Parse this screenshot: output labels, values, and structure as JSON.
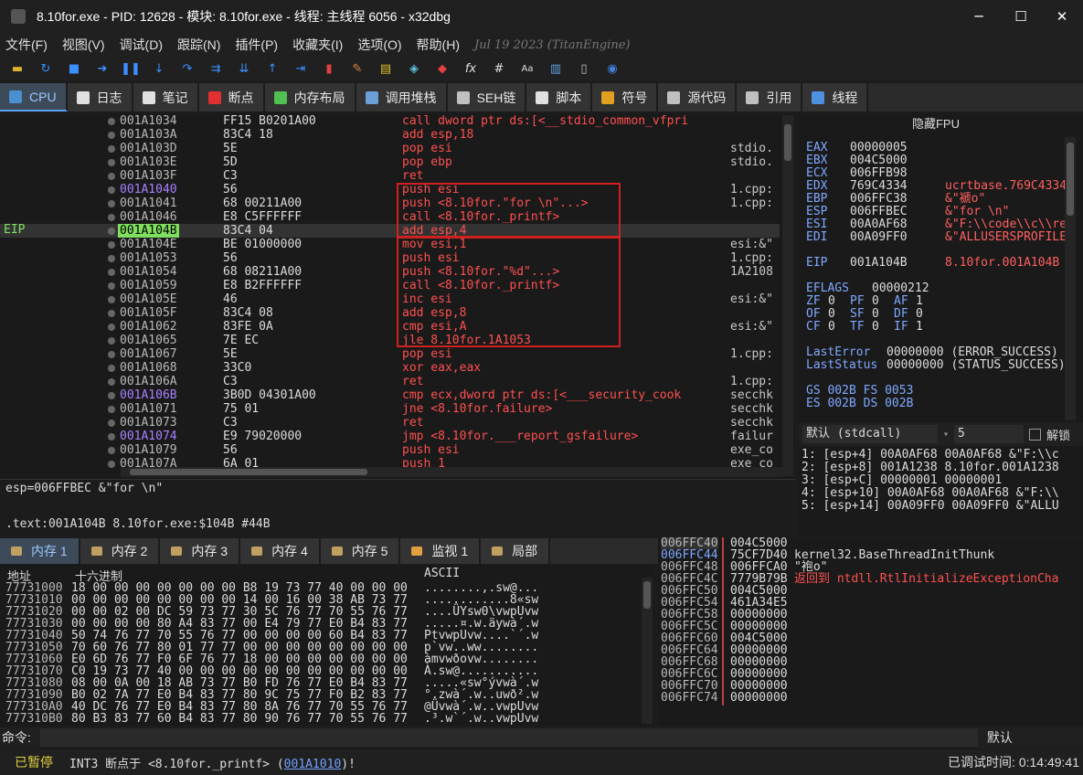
{
  "window": {
    "title": "8.10for.exe - PID: 12628 - 模块: 8.10for.exe - 线程: 主线程 6056 - x32dbg"
  },
  "menu": [
    "文件(F)",
    "视图(V)",
    "调试(D)",
    "跟踪(N)",
    "插件(P)",
    "收藏夹(I)",
    "选项(O)",
    "帮助(H)"
  ],
  "menu_date": "Jul 19 2023 (TitanEngine)",
  "tabs": [
    {
      "label": "CPU",
      "icon": "cpu-icon",
      "color": "#4a8fd0"
    },
    {
      "label": "日志",
      "icon": "log-icon",
      "color": "#e0e0e0"
    },
    {
      "label": "笔记",
      "icon": "notes-icon",
      "color": "#e0e0e0"
    },
    {
      "label": "断点",
      "icon": "breakpoint-icon",
      "color": "#e03030"
    },
    {
      "label": "内存布局",
      "icon": "memory-map-icon",
      "color": "#50c050"
    },
    {
      "label": "调用堆栈",
      "icon": "call-stack-icon",
      "color": "#6a9fd8"
    },
    {
      "label": "SEH链",
      "icon": "seh-icon",
      "color": "#c0c0c0"
    },
    {
      "label": "脚本",
      "icon": "script-icon",
      "color": "#e0e0e0"
    },
    {
      "label": "符号",
      "icon": "symbols-icon",
      "color": "#e0a020"
    },
    {
      "label": "源代码",
      "icon": "source-icon",
      "color": "#c0c0c0"
    },
    {
      "label": "引用",
      "icon": "references-icon",
      "color": "#c0c0c0"
    },
    {
      "label": "线程",
      "icon": "threads-icon",
      "color": "#5090e0"
    }
  ],
  "eip_label": "EIP",
  "disasm": [
    {
      "addr": "001A1034",
      "bytes": "FF15 B0201A00",
      "ins": "call dword ptr ds:[<__stdio_common_vfpri",
      "cmt": "",
      "lbl": false
    },
    {
      "addr": "001A103A",
      "bytes": "83C4 18",
      "ins": "add esp,18",
      "cmt": "",
      "lbl": false
    },
    {
      "addr": "001A103D",
      "bytes": "5E",
      "ins": "pop esi",
      "cmt": "stdio.",
      "lbl": false
    },
    {
      "addr": "001A103E",
      "bytes": "5D",
      "ins": "pop ebp",
      "cmt": "stdio.",
      "lbl": false
    },
    {
      "addr": "001A103F",
      "bytes": "C3",
      "ins": "ret",
      "cmt": "",
      "lbl": false
    },
    {
      "addr": "001A1040",
      "bytes": "56",
      "ins": "push esi",
      "cmt": "1.cpp:",
      "lbl": true
    },
    {
      "addr": "001A1041",
      "bytes": "68 00211A00",
      "ins": "push <8.10for.\"for \\n\"...>",
      "cmt": "1.cpp:",
      "lbl": false
    },
    {
      "addr": "001A1046",
      "bytes": "E8 C5FFFFFF",
      "ins": "call <8.10for._printf>",
      "cmt": "",
      "lbl": false
    },
    {
      "addr": "001A104B",
      "bytes": "83C4 04",
      "ins": "add esp,4",
      "cmt": "",
      "lbl": false,
      "eip": true
    },
    {
      "addr": "001A104E",
      "bytes": "BE 01000000",
      "ins": "mov esi,1",
      "cmt": "esi:&\"",
      "lbl": false
    },
    {
      "addr": "001A1053",
      "bytes": "56",
      "ins": "push esi",
      "cmt": "1.cpp:",
      "lbl": false
    },
    {
      "addr": "001A1054",
      "bytes": "68 08211A00",
      "ins": "push <8.10for.\"%d\"...>",
      "cmt": "1A2108",
      "lbl": false
    },
    {
      "addr": "001A1059",
      "bytes": "E8 B2FFFFFF",
      "ins": "call <8.10for._printf>",
      "cmt": "",
      "lbl": false
    },
    {
      "addr": "001A105E",
      "bytes": "46",
      "ins": "inc esi",
      "cmt": "esi:&\"",
      "lbl": false
    },
    {
      "addr": "001A105F",
      "bytes": "83C4 08",
      "ins": "add esp,8",
      "cmt": "",
      "lbl": false
    },
    {
      "addr": "001A1062",
      "bytes": "83FE 0A",
      "ins": "cmp esi,A",
      "cmt": "esi:&\"",
      "lbl": false
    },
    {
      "addr": "001A1065",
      "bytes": "7E EC",
      "ins": "jle 8.10for.1A1053",
      "cmt": "",
      "lbl": false
    },
    {
      "addr": "001A1067",
      "bytes": "5E",
      "ins": "pop esi",
      "cmt": "1.cpp:",
      "lbl": false
    },
    {
      "addr": "001A1068",
      "bytes": "33C0",
      "ins": "xor eax,eax",
      "cmt": "",
      "lbl": false
    },
    {
      "addr": "001A106A",
      "bytes": "C3",
      "ins": "ret",
      "cmt": "1.cpp:",
      "lbl": false
    },
    {
      "addr": "001A106B",
      "bytes": "3B0D 04301A00",
      "ins": "cmp ecx,dword ptr ds:[<___security_cook",
      "cmt": "secchk",
      "lbl": true
    },
    {
      "addr": "001A1071",
      "bytes": "75 01",
      "ins": "jne <8.10for.failure>",
      "cmt": "secchk",
      "lbl": false
    },
    {
      "addr": "001A1073",
      "bytes": "C3",
      "ins": "ret",
      "cmt": "secchk",
      "lbl": false
    },
    {
      "addr": "001A1074",
      "bytes": "E9 79020000",
      "ins": "jmp <8.10for.___report_gsfailure>",
      "cmt": "failur",
      "lbl": true
    },
    {
      "addr": "001A1079",
      "bytes": "56",
      "ins": "push esi",
      "cmt": "exe_co",
      "lbl": false
    },
    {
      "addr": "001A107A",
      "bytes": "6A 01",
      "ins": "push 1",
      "cmt": "exe_co",
      "lbl": false
    }
  ],
  "info_line1": "esp=006FFBEC &\"for \\n\"",
  "info_line2": ".text:001A104B 8.10for.exe:$104B #44B",
  "registers": {
    "title": "隐藏FPU",
    "gp": [
      {
        "name": "EAX",
        "val": "00000005",
        "hint": ""
      },
      {
        "name": "EBX",
        "val": "004C5000",
        "hint": ""
      },
      {
        "name": "ECX",
        "val": "006FFB98",
        "hint": ""
      },
      {
        "name": "EDX",
        "val": "769C4334",
        "hint": "ucrtbase.769C4334"
      },
      {
        "name": "EBP",
        "val": "006FFC38",
        "hint": "&\"褫o\""
      },
      {
        "name": "ESP",
        "val": "006FFBEC",
        "hint": "&\"for \\n\""
      },
      {
        "name": "ESI",
        "val": "00A0AF68",
        "hint": "&\"F:\\\\code\\\\c\\\\re"
      },
      {
        "name": "EDI",
        "val": "00A09FF0",
        "hint": "&\"ALLUSERSPROFILE"
      }
    ],
    "eip": {
      "name": "EIP",
      "val": "001A104B",
      "hint": "8.10for.001A104B"
    },
    "eflags": {
      "name": "EFLAGS",
      "val": "00000212"
    },
    "flags": [
      [
        "ZF",
        "0",
        "PF",
        "0",
        "AF",
        "1"
      ],
      [
        "OF",
        "0",
        "SF",
        "0",
        "DF",
        "0"
      ],
      [
        "CF",
        "0",
        "TF",
        "0",
        "IF",
        "1"
      ]
    ],
    "lasterror": {
      "name": "LastError",
      "val": "00000000 (ERROR_SUCCESS)"
    },
    "laststatus": {
      "name": "LastStatus",
      "val": "00000000 (STATUS_SUCCESS)"
    },
    "seg1": "GS 002B   FS 0053",
    "seg2": "ES 002B   DS 002B"
  },
  "callconv": {
    "selected": "默认 (stdcall)",
    "argcount": "5",
    "lock_label": "解锁"
  },
  "args": [
    "1: [esp+4] 00A0AF68 00A0AF68 &\"F:\\\\c",
    "2: [esp+8] 001A1238 8.10for.001A1238",
    "3: [esp+C] 00000001 00000001",
    "4: [esp+10] 00A0AF68 00A0AF68 &\"F:\\\\",
    "5: [esp+14] 00A09FF0 00A09FF0 &\"ALLU"
  ],
  "bottom_tabs": [
    "内存 1",
    "内存 2",
    "内存 3",
    "内存 4",
    "内存 5",
    "监视 1",
    "局部"
  ],
  "dump": {
    "col_addr": "地址",
    "col_hex": "十六进制",
    "col_ascii": "ASCII",
    "rows": [
      {
        "a": "77731000",
        "h": "18 00 00 00 00 00 00 00 B8 19 73 77 40 00 00 00",
        "s": "........,.sw@..."
      },
      {
        "a": "77731010",
        "h": "00 00 00 00 00 00 00 00 14 00 16 00 38 AB 73 77",
        "s": "............8«sw"
      },
      {
        "a": "77731020",
        "h": "00 00 02 00 DC 59 73 77 30 5C 76 77 70 55 76 77",
        "s": "....ÜYsw0\\vwpUvw"
      },
      {
        "a": "77731030",
        "h": "00 00 00 00 80 A4 83 77 00 E4 79 77 E0 B4 83 77",
        "s": ".....¤.w.äywà´.w"
      },
      {
        "a": "77731040",
        "h": "50 74 76 77 70 55 76 77 00 00 00 00 60 B4 83 77",
        "s": "PtvwpUvw....`´.w"
      },
      {
        "a": "77731050",
        "h": "70 60 76 77 80 01 77 77 00 00 00 00 00 00 00 00",
        "s": "p`vw..ww........"
      },
      {
        "a": "77731060",
        "h": "E0 6D 76 77 F0 6F 76 77 18 00 00 00 00 00 00 00",
        "s": "àmvwðovw........"
      },
      {
        "a": "77731070",
        "h": "C0 19 73 77 40 00 00 00 00 00 00 00 00 00 00 00",
        "s": "À.sw@..........."
      },
      {
        "a": "77731080",
        "h": "08 00 0A 00 18 AB 73 77 B0 FD 76 77 E0 B4 83 77",
        "s": ".....«sw°ývwà´.w"
      },
      {
        "a": "77731090",
        "h": "B0 02 7A 77 E0 B4 83 77 80 9C 75 77 F0 B2 83 77",
        "s": "°.zwà´.w..uwð².w"
      },
      {
        "a": "777310A0",
        "h": "40 DC 76 77 E0 B4 83 77 80 8A 76 77 70 55 76 77",
        "s": "@Üvwà´.w..vwpUvw"
      },
      {
        "a": "777310B0",
        "h": "80 B3 83 77 60 B4 83 77 80 90 76 77 70 55 76 77",
        "s": ".³.w`´.w..vwpUvw"
      }
    ]
  },
  "stack": [
    {
      "a": "006FFC40",
      "v": "004C5000",
      "c": ""
    },
    {
      "a": "006FFC44",
      "v": "75CF7D40",
      "c": "kernel32.BaseThreadInitThunk"
    },
    {
      "a": "006FFC48",
      "v": "006FFCA0",
      "c": "\"袍o\""
    },
    {
      "a": "006FFC4C",
      "v": "7779B79B",
      "c": "返回到 ntdll.RtlInitializeExceptionCha"
    },
    {
      "a": "006FFC50",
      "v": "004C5000",
      "c": ""
    },
    {
      "a": "006FFC54",
      "v": "461A34E5",
      "c": ""
    },
    {
      "a": "006FFC58",
      "v": "00000000",
      "c": ""
    },
    {
      "a": "006FFC5C",
      "v": "00000000",
      "c": ""
    },
    {
      "a": "006FFC60",
      "v": "004C5000",
      "c": ""
    },
    {
      "a": "006FFC64",
      "v": "00000000",
      "c": ""
    },
    {
      "a": "006FFC68",
      "v": "00000000",
      "c": ""
    },
    {
      "a": "006FFC6C",
      "v": "00000000",
      "c": ""
    },
    {
      "a": "006FFC70",
      "v": "00000000",
      "c": ""
    },
    {
      "a": "006FFC74",
      "v": "00000000",
      "c": ""
    }
  ],
  "command": {
    "label": "命令:",
    "mode": "默认"
  },
  "status": {
    "state": "已暂停",
    "message": "INT3 断点于 <8.10for._printf> (",
    "link": "001A1010",
    "tail": ")!",
    "time": "已调试时间:  0:14:49:41"
  }
}
